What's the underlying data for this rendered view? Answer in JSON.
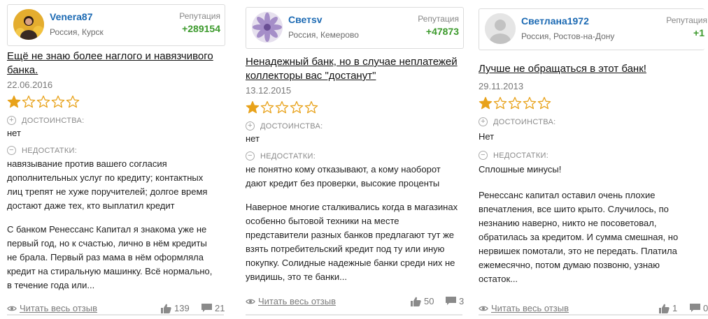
{
  "common": {
    "reputation_label": "Репутация",
    "pros_label": "ДОСТОИНСТВА:",
    "cons_label": "НЕДОСТАТКИ:",
    "read_full_label": "Читать весь отзыв",
    "star_filled_color": "#e8a21a",
    "username_color": "#1c6ab3",
    "reputation_color": "#3c9a2c"
  },
  "reviews": [
    {
      "username": "Venera87",
      "location": "Россия, Курск",
      "reputation": "+289154",
      "avatar_icon": "user-photo-icon",
      "title": "Ещё не знаю более наглого и навязчивого банка.",
      "date": "22.06.2016",
      "rating": 1,
      "rating_max": 5,
      "pros": "нет",
      "cons": "навязывание против вашего согласия дополнительных услуг по кредиту; контактных лиц трепят не хуже поручителей; долгое время достают даже тех, кто выплатил кредит",
      "body": "С банком Ренессанс Капитал я знакома уже не первый год, но к счастью, лично в нём кредиты не брала. Первый раз мама в нём оформляла кредит на стиральную машинку. Всё нормально, в течение года или...",
      "likes": "139",
      "comments": "21"
    },
    {
      "username": "Cветsv",
      "location": "Россия, Кемерово",
      "reputation": "+47873",
      "avatar_icon": "flower-photo-icon",
      "title": "Ненадежный банк, но в случае неплатежей коллекторы вас \"достанут\"",
      "date": "13.12.2015",
      "rating": 1,
      "rating_max": 5,
      "pros": "нет",
      "cons": "не понятно кому отказывают, а кому наоборот дают кредит без проверки, высокие проценты",
      "body": "Наверное многие сталкивались когда в магазинах особенно бытовой техники на месте представители разных банков предлагают тут же взять потребительский кредит под ту или иную покупку. Солидные надежные банки среди них не увидишь, это те банки...",
      "likes": "50",
      "comments": "3"
    },
    {
      "username": "Светлана1972",
      "location": "Россия, Ростов-на-Дону",
      "reputation": "+1",
      "avatar_icon": "default-user-icon",
      "title": "Лучше не обращаться в этот банк!",
      "date": "29.11.2013",
      "rating": 1,
      "rating_max": 5,
      "pros": "Нет",
      "cons": "Сплошные минусы!",
      "body": "Ренессанс капитал оставил очень плохие впечатления, все шито крыто. Случилось, по незнанию наверно, никто не посоветовал, обратилась за кредитом. И сумма смешная, но нервишек помотали, это не передать. Платила ежемесячно, потом думаю позвоню, узнаю остаток...",
      "likes": "1",
      "comments": "0"
    }
  ]
}
